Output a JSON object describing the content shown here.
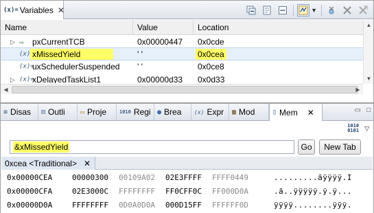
{
  "variables_view": {
    "icon": "(x)=",
    "title": "Variables",
    "close": "✕",
    "toolbar_icons": [
      "collapse-all-icon",
      "show-type-names-icon",
      "layout-icon",
      "select-all-icon",
      "remove-icon",
      "remove-all-icon"
    ],
    "columns": [
      "Name",
      "Value",
      "Location"
    ],
    "rows": [
      {
        "name": "pxCurrentTCB",
        "value": "0x00000447",
        "location": "0x0cde",
        "kind": "pointer",
        "expandable": true,
        "selected": false
      },
      {
        "name": "xMissedYield",
        "value": "' '",
        "location": "0x0cea",
        "kind": "variable",
        "expandable": false,
        "selected": true
      },
      {
        "name": "uxSchedulerSuspended",
        "value": "' '",
        "location": "0x0ce8",
        "kind": "variable",
        "expandable": false,
        "selected": false
      },
      {
        "name": "xDelayedTaskList1",
        "value": "0x00000d33",
        "location": "0x0d33",
        "kind": "variable",
        "expandable": true,
        "selected": false
      }
    ]
  },
  "lower_tabs": [
    {
      "label": "Disas",
      "icon": "disassembly-icon",
      "glyph": "≡"
    },
    {
      "label": "Outli",
      "icon": "outline-icon",
      "glyph": "⊟"
    },
    {
      "label": "Proje",
      "icon": "project-icon",
      "glyph": "▭"
    },
    {
      "label": "Regi",
      "icon": "registers-icon",
      "glyph": "1010"
    },
    {
      "label": "Brea",
      "icon": "breakpoints-icon",
      "glyph": "●"
    },
    {
      "label": "Expr",
      "icon": "expressions-icon",
      "glyph": "(x)"
    },
    {
      "label": "Mod",
      "icon": "modules-icon",
      "glyph": "▦"
    },
    {
      "label": "Mem",
      "icon": "memory-icon",
      "glyph": "▯",
      "active": true,
      "close": "✕"
    }
  ],
  "memory_view": {
    "address_input": "&xMissedYield",
    "go_label": "Go",
    "new_tab_label": "New Tab",
    "rendering_tab": {
      "label": "0xcea <Traditional>",
      "close": "✕"
    },
    "rows": [
      {
        "address": "0x00000CEA",
        "cells": [
          "00000300",
          "00109A02",
          "02E3FFFF",
          "FFFF0449"
        ],
        "dim": [
          false,
          true,
          false,
          true
        ],
        "ascii": ".........ãÿÿÿÿ.I"
      },
      {
        "address": "0x00000CFA",
        "cells": [
          "02E3000C",
          "FFFFFFFF",
          "FF0CFF0C",
          "FF000D0A"
        ],
        "dim": [
          false,
          true,
          false,
          true
        ],
        "ascii": ".ã..ÿÿÿÿÿ.ÿ.ÿ..."
      },
      {
        "address": "0x00000D0A",
        "cells": [
          "FFFFFFFF",
          "0D0A0D0A",
          "000D15FF",
          "FFFFFF0D"
        ],
        "dim": [
          false,
          true,
          false,
          true
        ],
        "ascii": "ÿÿÿÿ........ÿÿÿ."
      }
    ]
  },
  "colors": {
    "highlight": "#ffff66",
    "selection": "#e6f0fb",
    "dim_text": "#8a8a8a"
  }
}
